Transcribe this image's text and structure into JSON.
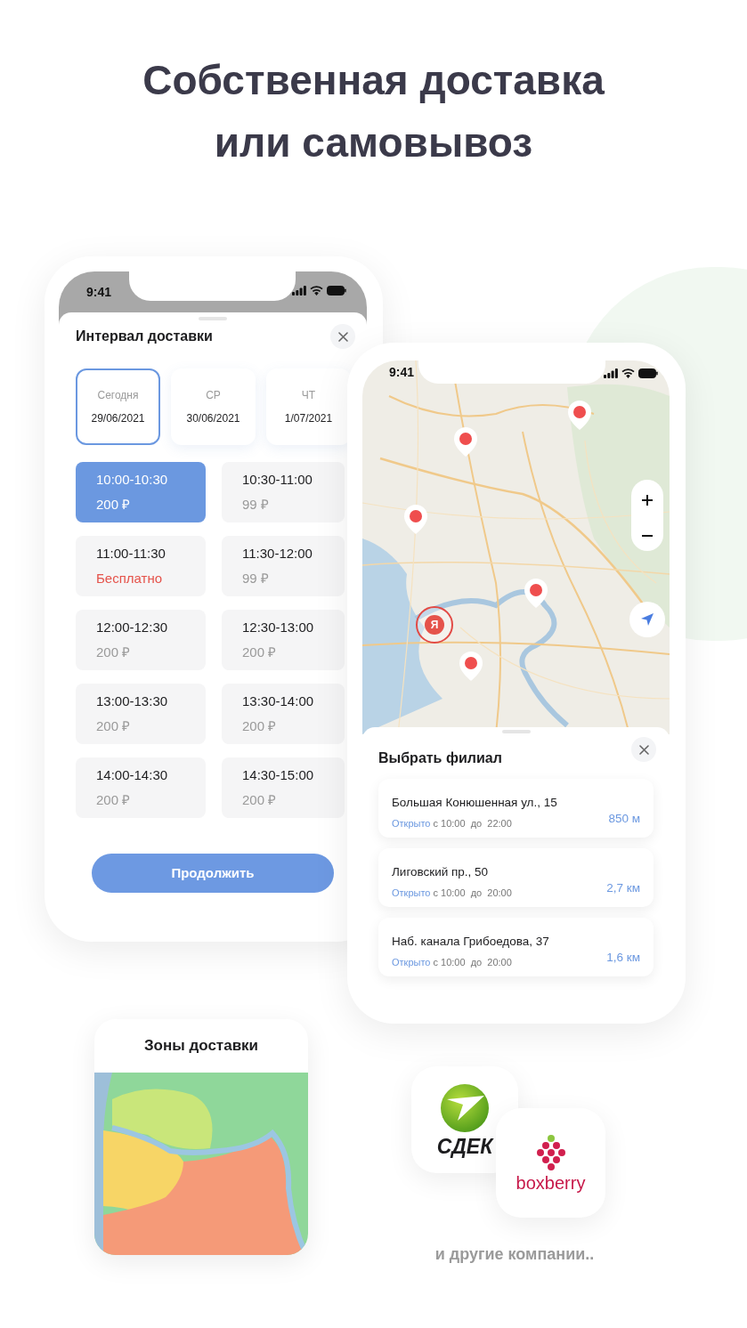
{
  "headline": [
    "Собственная доставка",
    "или самовывоз"
  ],
  "delivery_phone": {
    "status_time": "9:41",
    "title": "Интервал доставки",
    "days": [
      {
        "label": "Сегодня",
        "date": "29/06/2021",
        "selected": true
      },
      {
        "label": "СР",
        "date": "30/06/2021",
        "selected": false
      },
      {
        "label": "ЧТ",
        "date": "1/07/2021",
        "selected": false
      }
    ],
    "slots": [
      {
        "time": "10:00-10:30",
        "price": "200 ₽",
        "selected": true,
        "free": false
      },
      {
        "time": "10:30-11:00",
        "price": "99 ₽",
        "selected": false,
        "free": false
      },
      {
        "time": "11:00-11:30",
        "price": "Бесплатно",
        "selected": false,
        "free": true
      },
      {
        "time": "11:30-12:00",
        "price": "99 ₽",
        "selected": false,
        "free": false
      },
      {
        "time": "12:00-12:30",
        "price": "200 ₽",
        "selected": false,
        "free": false
      },
      {
        "time": "12:30-13:00",
        "price": "200 ₽",
        "selected": false,
        "free": false
      },
      {
        "time": "13:00-13:30",
        "price": "200 ₽",
        "selected": false,
        "free": false
      },
      {
        "time": "13:30-14:00",
        "price": "200 ₽",
        "selected": false,
        "free": false
      },
      {
        "time": "14:00-14:30",
        "price": "200 ₽",
        "selected": false,
        "free": false
      },
      {
        "time": "14:30-15:00",
        "price": "200 ₽",
        "selected": false,
        "free": false
      }
    ],
    "button": "Продолжить"
  },
  "branch_phone": {
    "status_time": "9:41",
    "marker_label": "Я",
    "title": "Выбрать филиал",
    "branches": [
      {
        "address": "Большая Конюшенная ул., 15",
        "status": "Открыто",
        "hours": "с 10:00  до  22:00",
        "distance": "850 м"
      },
      {
        "address": "Лиговский пр., 50",
        "status": "Открыто",
        "hours": "с 10:00  до  20:00",
        "distance": "2,7 км"
      },
      {
        "address": "Наб. канала Грибоедова, 37",
        "status": "Открыто",
        "hours": "с 10:00  до  20:00",
        "distance": "1,6 км"
      }
    ]
  },
  "zones_card": {
    "title": "Зоны доставки"
  },
  "partners": [
    {
      "kind": "cdek",
      "name": "СДЕК"
    },
    {
      "kind": "boxberry",
      "name": "boxberry"
    }
  ],
  "partners_note": "и другие компании.."
}
